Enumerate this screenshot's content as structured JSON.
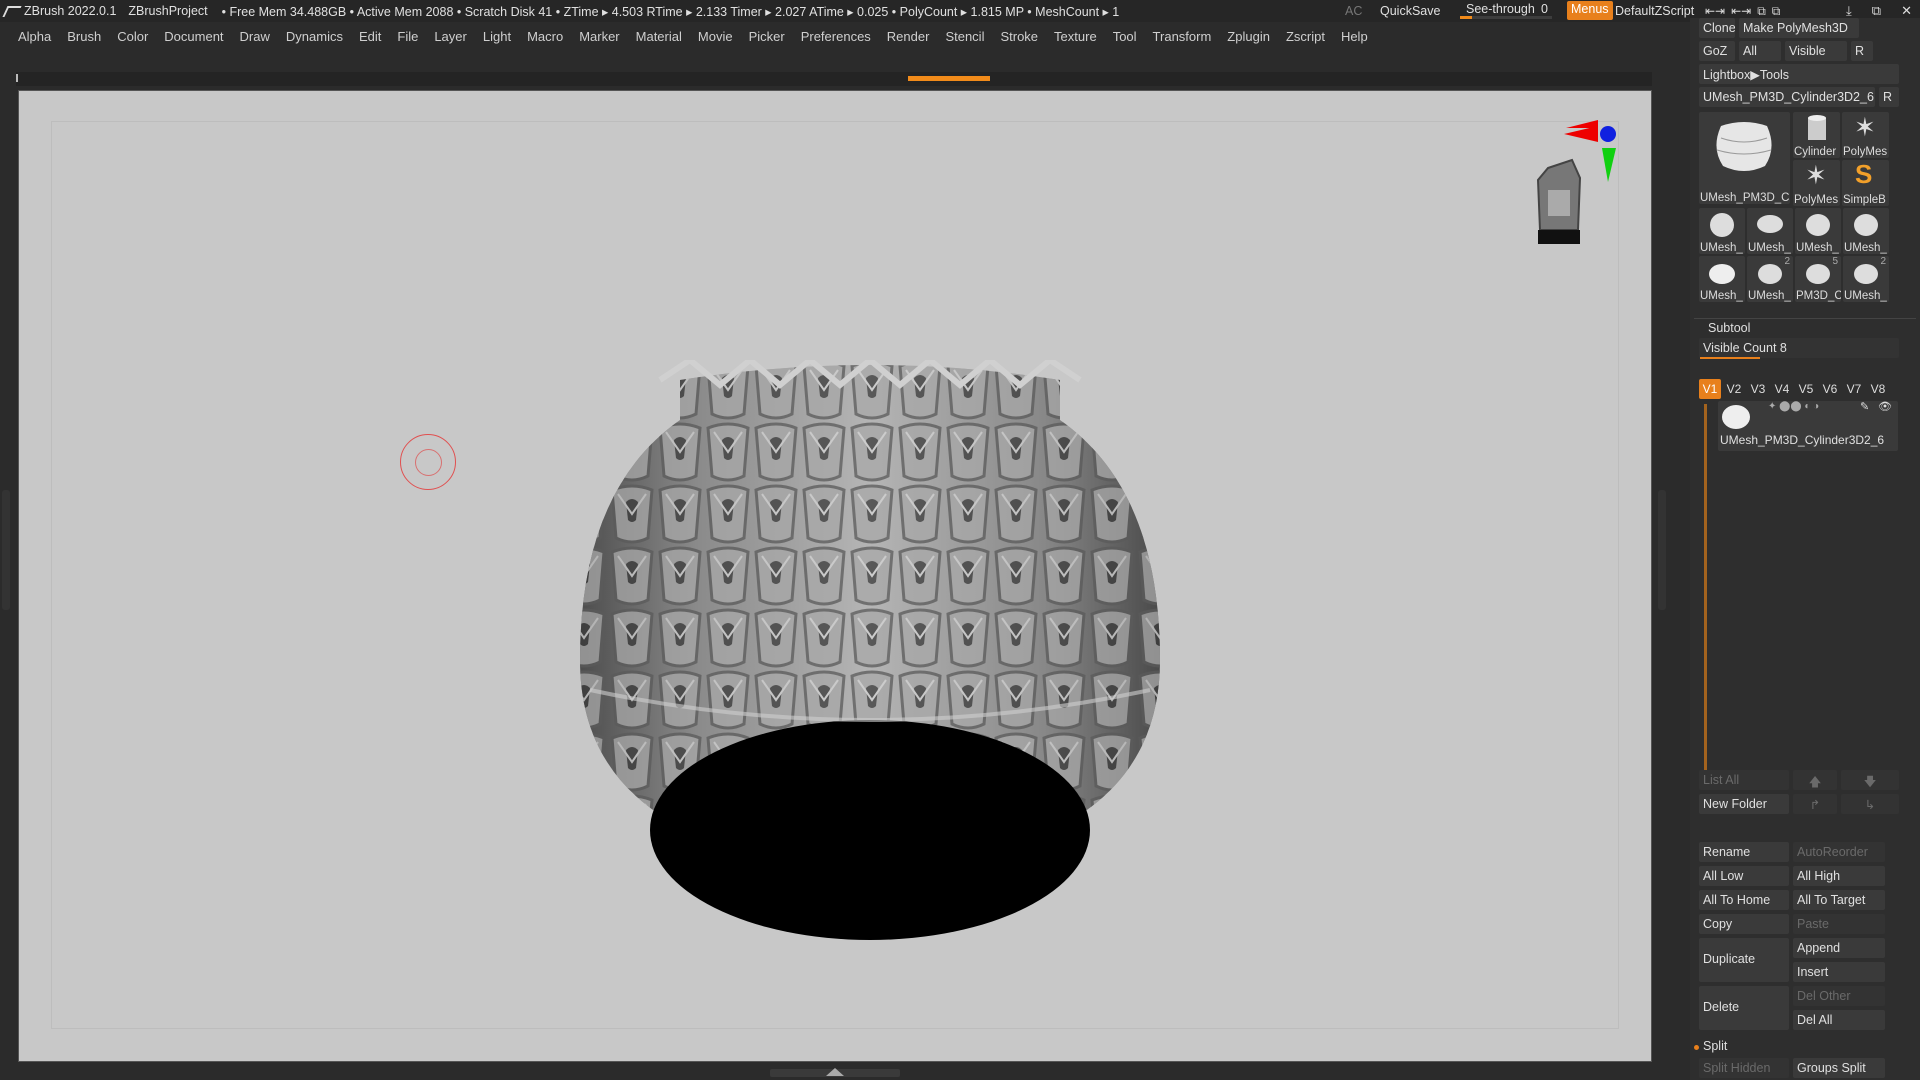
{
  "titlebar": {
    "app": "ZBrush 2022.0.1",
    "project": "ZBrushProject",
    "stats": "• Free Mem 34.488GB • Active Mem 2088 • Scratch Disk 41 • ZTime ▸ 4.503 RTime ▸ 2.133 Timer ▸ 2.027 ATime ▸ 0.025 • PolyCount ▸ 1.815 MP • MeshCount ▸ 1",
    "ac": "AC",
    "quicksave": "QuickSave",
    "see_through_label": "See-through",
    "see_through_value": "0",
    "see_through_level": 0,
    "menus": "Menus",
    "zscript": "DefaultZScript"
  },
  "menubar": [
    "Alpha",
    "Brush",
    "Color",
    "Document",
    "Draw",
    "Dynamics",
    "Edit",
    "File",
    "Layer",
    "Light",
    "Macro",
    "Marker",
    "Material",
    "Movie",
    "Picker",
    "Preferences",
    "Render",
    "Stencil",
    "Stroke",
    "Texture",
    "Tool",
    "Transform",
    "Zplugin",
    "Zscript",
    "Help"
  ],
  "tool_panel": {
    "clone": "Clone",
    "make_polymesh": "Make PolyMesh3D",
    "goz": "GoZ",
    "all": "All",
    "visible": "Visible",
    "r": "R",
    "lightbox": "Lightbox▶Tools",
    "current_tool": "UMesh_PM3D_Cylinder3D2_6",
    "r2": "R",
    "main_thumb": "UMesh_PM3D_C",
    "thumbs_right": [
      "Cylinder",
      "PolyMes",
      "PolyMes",
      "SimpleB"
    ],
    "thumb_row1": [
      "UMesh_",
      "UMesh_",
      "UMesh_",
      "UMesh_"
    ],
    "thumb_row2": [
      "UMesh_",
      "UMesh_",
      "PM3D_C",
      "UMesh_"
    ],
    "thumb_row2_badges": [
      "2",
      "5",
      "2"
    ]
  },
  "subtool": {
    "title": "Subtool",
    "visible_count": "Visible Count 8",
    "versions": [
      "V1",
      "V2",
      "V3",
      "V4",
      "V5",
      "V6",
      "V7",
      "V8"
    ],
    "item_name": "UMesh_PM3D_Cylinder3D2_6",
    "list_all": "List All",
    "new_folder": "New Folder",
    "rename": "Rename",
    "autoreorder": "AutoReorder",
    "all_low": "All Low",
    "all_high": "All High",
    "all_to_home": "All To Home",
    "all_to_target": "All To Target",
    "copy": "Copy",
    "paste": "Paste",
    "duplicate": "Duplicate",
    "append": "Append",
    "insert": "Insert",
    "delete": "Delete",
    "del_other": "Del Other",
    "del_all": "Del All",
    "split": "Split",
    "split_hidden": "Split Hidden",
    "groups_split": "Groups Split"
  },
  "colors": {
    "accent": "#e8801c",
    "canvas": "#c8c8c8",
    "panel": "#2e2e2e"
  }
}
